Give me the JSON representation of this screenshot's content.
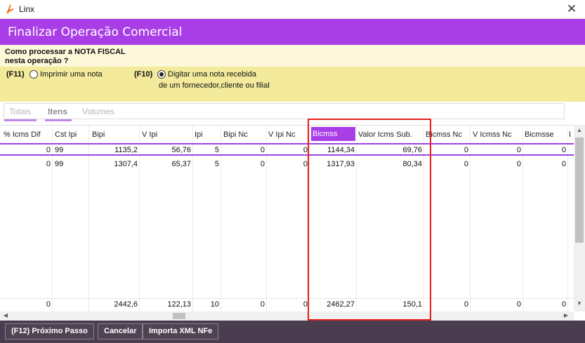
{
  "window": {
    "title": "Linx",
    "close_glyph": "✕",
    "logo_icon": "linx-logo-icon"
  },
  "header": {
    "title": "Finalizar Operação Comercial"
  },
  "question": {
    "line1": "Como processar a NOTA FISCAL",
    "line2": "nesta operação ?",
    "options": [
      {
        "key": "(F11)",
        "label": "Imprimir uma nota",
        "selected": false
      },
      {
        "key": "(F10)",
        "label_line1": "Digitar uma nota recebida",
        "label_line2": "de um fornecedor,cliente ou filial",
        "selected": true
      }
    ]
  },
  "tabs": [
    {
      "label": "Totais",
      "active": false
    },
    {
      "label": "Itens",
      "active": true
    },
    {
      "label": "Volumes",
      "active": false
    }
  ],
  "grid": {
    "columns": [
      "% Icms Dif",
      "Cst Ipi",
      "Bipi",
      "V Ipi",
      "Ipi",
      "Bipi Nc",
      "V Ipi Nc",
      "Bicmss",
      "Valor Icms Sub.",
      "Bicmss Nc",
      "V Icmss Nc",
      "Bicmsse",
      "I"
    ],
    "highlighted_column": "Bicmss",
    "rows": [
      [
        "0",
        "99",
        "1135,2",
        "56,76",
        "5",
        "0",
        "0",
        "1144,34",
        "69,76",
        "0",
        "0",
        "0"
      ],
      [
        "0",
        "99",
        "1307,4",
        "65,37",
        "5",
        "0",
        "0",
        "1317,93",
        "80,34",
        "0",
        "0",
        "0"
      ]
    ],
    "totals": [
      "0",
      "",
      "2442,6",
      "122,13",
      "10",
      "0",
      "0",
      "2462,27",
      "150,1",
      "0",
      "0",
      "0"
    ]
  },
  "scroll": {
    "up": "▲",
    "down": "▼",
    "left": "◀",
    "right": "▶"
  },
  "footer": {
    "next_label": "(F12) Próximo Passo",
    "cancel_label": "Cancelar",
    "import_label": "Importa XML NFe"
  },
  "colors": {
    "accent": "#a93ee6",
    "footer": "#4a3d50",
    "question_bg": "#f3ea9c",
    "annotation": "#e81c1c"
  }
}
